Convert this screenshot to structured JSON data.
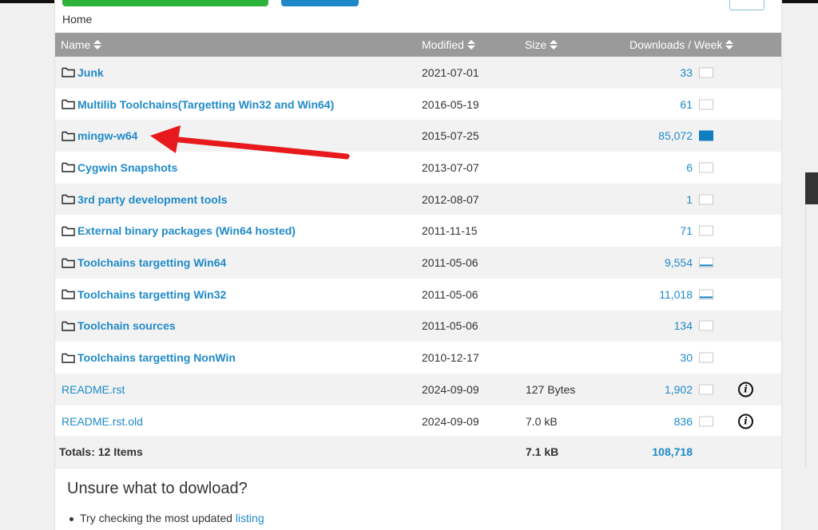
{
  "breadcrumb": "Home",
  "table": {
    "headers": {
      "name": "Name",
      "modified": "Modified",
      "size": "Size",
      "downloads": "Downloads / Week"
    },
    "rows": [
      {
        "name": "Junk",
        "modified": "2021-07-01",
        "size": "",
        "downloads": "33",
        "type": "folder",
        "chart": "empty"
      },
      {
        "name": "Multilib Toolchains(Targetting Win32 and Win64)",
        "modified": "2016-05-19",
        "size": "",
        "downloads": "61",
        "type": "folder",
        "chart": "empty"
      },
      {
        "name": "mingw-w64",
        "modified": "2015-07-25",
        "size": "",
        "downloads": "85,072",
        "type": "folder",
        "chart": "full"
      },
      {
        "name": "Cygwin Snapshots",
        "modified": "2013-07-07",
        "size": "",
        "downloads": "6",
        "type": "folder",
        "chart": "empty"
      },
      {
        "name": "3rd party development tools",
        "modified": "2012-08-07",
        "size": "",
        "downloads": "1",
        "type": "folder",
        "chart": "empty"
      },
      {
        "name": "External binary packages (Win64 hosted)",
        "modified": "2011-11-15",
        "size": "",
        "downloads": "71",
        "type": "folder",
        "chart": "empty"
      },
      {
        "name": "Toolchains targetting Win64",
        "modified": "2011-05-06",
        "size": "",
        "downloads": "9,554",
        "type": "folder",
        "chart": "line"
      },
      {
        "name": "Toolchains targetting Win32",
        "modified": "2011-05-06",
        "size": "",
        "downloads": "11,018",
        "type": "folder",
        "chart": "line"
      },
      {
        "name": "Toolchain sources",
        "modified": "2011-05-06",
        "size": "",
        "downloads": "134",
        "type": "folder",
        "chart": "empty"
      },
      {
        "name": "Toolchains targetting NonWin",
        "modified": "2010-12-17",
        "size": "",
        "downloads": "30",
        "type": "folder",
        "chart": "empty"
      },
      {
        "name": "README.rst",
        "modified": "2024-09-09",
        "size": "127 Bytes",
        "downloads": "1,902",
        "type": "file",
        "chart": "empty"
      },
      {
        "name": "README.rst.old",
        "modified": "2024-09-09",
        "size": "7.0 kB",
        "downloads": "836",
        "type": "file",
        "chart": "empty"
      }
    ],
    "totals": {
      "label": "Totals: 12 Items",
      "size": "7.1 kB",
      "downloads": "108,718"
    }
  },
  "help": {
    "title": "Unsure what to dowload?",
    "item_text": "Try checking the most updated ",
    "item_link": "listing"
  },
  "colors": {
    "link": "#1f8ac9",
    "header_bg": "#9a9a9a",
    "annotation_arrow": "#e8191c"
  }
}
